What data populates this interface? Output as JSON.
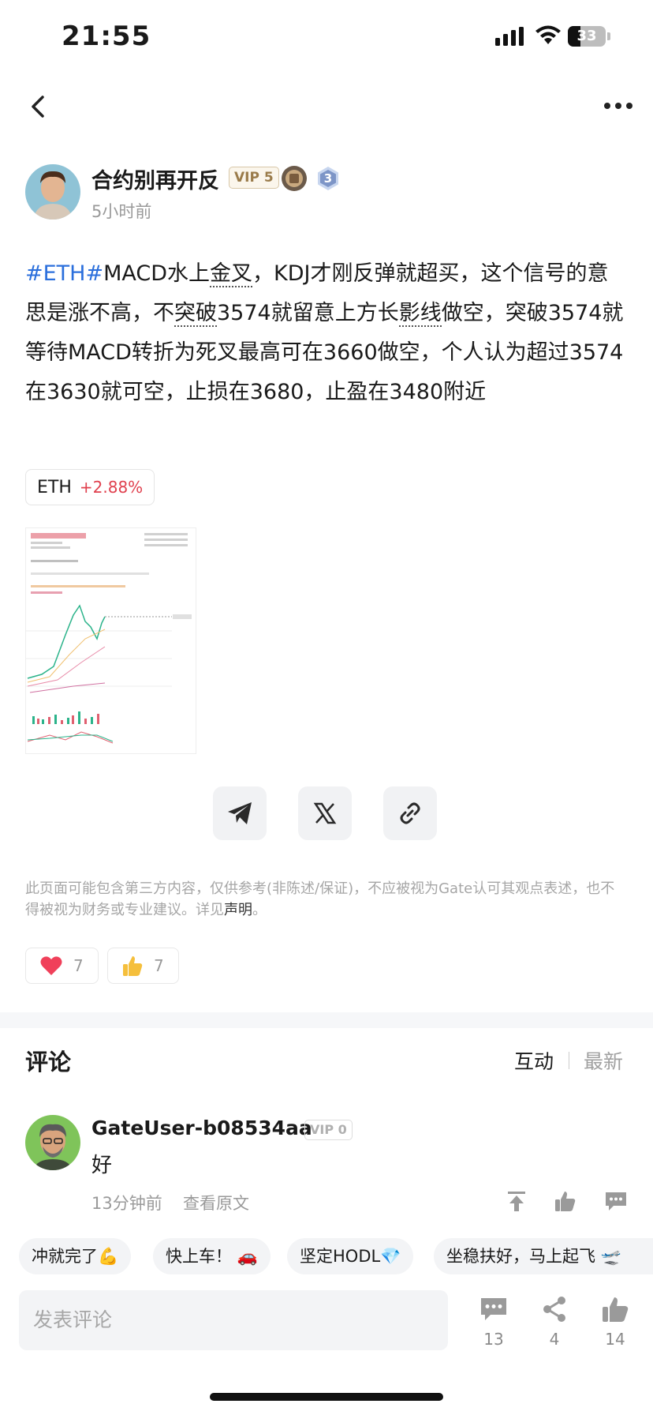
{
  "status_bar": {
    "time": "21:55",
    "battery": "33"
  },
  "post": {
    "author": "合约别再开反",
    "vip": "VIP 5",
    "level_badge": "3",
    "time_ago": "5小时前",
    "content": {
      "tag": "#ETH#",
      "p1": "MACD水上",
      "u1": "金叉",
      "p2": "，KDJ才刚反弹就超买，这个信号的意思是涨不高，不",
      "u2": "突破",
      "p3": "3574就留意上方长",
      "u3": "影线",
      "p4": "做空，突破3574就等待MACD转折为死叉最高可在3660做空，个人认为超过3574在3630就可空，止损在3680，止盈在3480附近"
    },
    "ticker": {
      "symbol": "ETH",
      "change": "+2.88%"
    }
  },
  "share": {
    "telegram": "telegram-icon",
    "x": "x-icon",
    "link": "link-icon"
  },
  "disclaimer": {
    "text": "此页面可能包含第三方内容，仅供参考(非陈述/保证)，不应被视为Gate认可其观点表述，也不得被视为财务或专业建议。详见",
    "link": "声明",
    "end": "。"
  },
  "reactions": {
    "heart": "7",
    "thumb": "7"
  },
  "comments": {
    "title": "评论",
    "sort_interactive": "互动",
    "sort_latest": "最新",
    "items": [
      {
        "user": "GateUser-b08534aa",
        "vip": "VIP 0",
        "text": "好",
        "time": "13分钟前",
        "view_original": "查看原文"
      }
    ]
  },
  "quick_replies": [
    "冲就完了💪",
    "快上车！ 🚗",
    "坚定HODL💎",
    "坐稳扶好，马上起飞 🛫"
  ],
  "bottom_bar": {
    "placeholder": "发表评论",
    "comments": "13",
    "shares": "4",
    "likes": "14"
  },
  "colors": {
    "accent_blue": "#2b6fdc",
    "up_red": "#e0404e"
  }
}
